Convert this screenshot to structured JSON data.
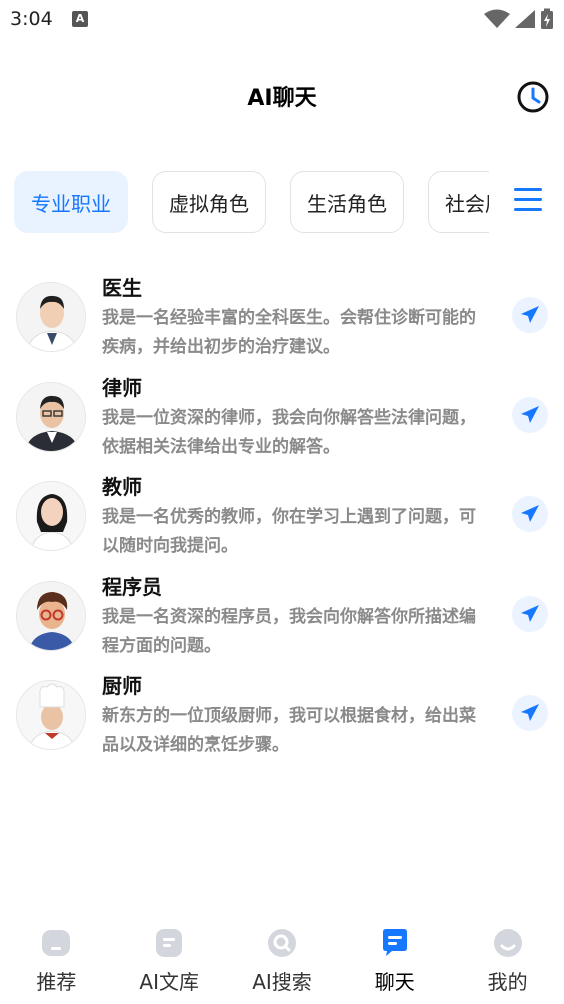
{
  "status_bar": {
    "time": "3:04",
    "notif_glyph": "A"
  },
  "header": {
    "title": "AI聊天"
  },
  "tabs": [
    {
      "label": "专业职业",
      "active": true
    },
    {
      "label": "虚拟角色",
      "active": false
    },
    {
      "label": "生活角色",
      "active": false
    },
    {
      "label": "社会层次",
      "active": false
    }
  ],
  "roles": [
    {
      "name": "医生",
      "desc": "我是一名经验丰富的全科医生。会帮住诊断可能的疾病，并给出初步的治疗建议。"
    },
    {
      "name": "律师",
      "desc": "我是一位资深的律师，我会向你解答些法律问题，依据相关法律给出专业的解答。"
    },
    {
      "name": "教师",
      "desc": "我是一名优秀的教师，你在学习上遇到了问题，可以随时向我提问。"
    },
    {
      "name": "程序员",
      "desc": "我是一名资深的程序员，我会向你解答你所描述编程方面的问题。"
    },
    {
      "name": "厨师",
      "desc": "新东方的一位顶级厨师，我可以根据食材，给出菜品以及详细的烹饪步骤。"
    }
  ],
  "bottom_nav": [
    {
      "label": "推荐",
      "icon": "home-icon",
      "active": false
    },
    {
      "label": "AI文库",
      "icon": "library-icon",
      "active": false
    },
    {
      "label": "AI搜索",
      "icon": "search-icon",
      "active": false
    },
    {
      "label": "聊天",
      "icon": "chat-icon",
      "active": true
    },
    {
      "label": "我的",
      "icon": "profile-icon",
      "active": false
    }
  ],
  "colors": {
    "accent": "#1677ff",
    "accent_bg": "#e8f3ff",
    "inactive_icon": "#d3d6dc"
  }
}
